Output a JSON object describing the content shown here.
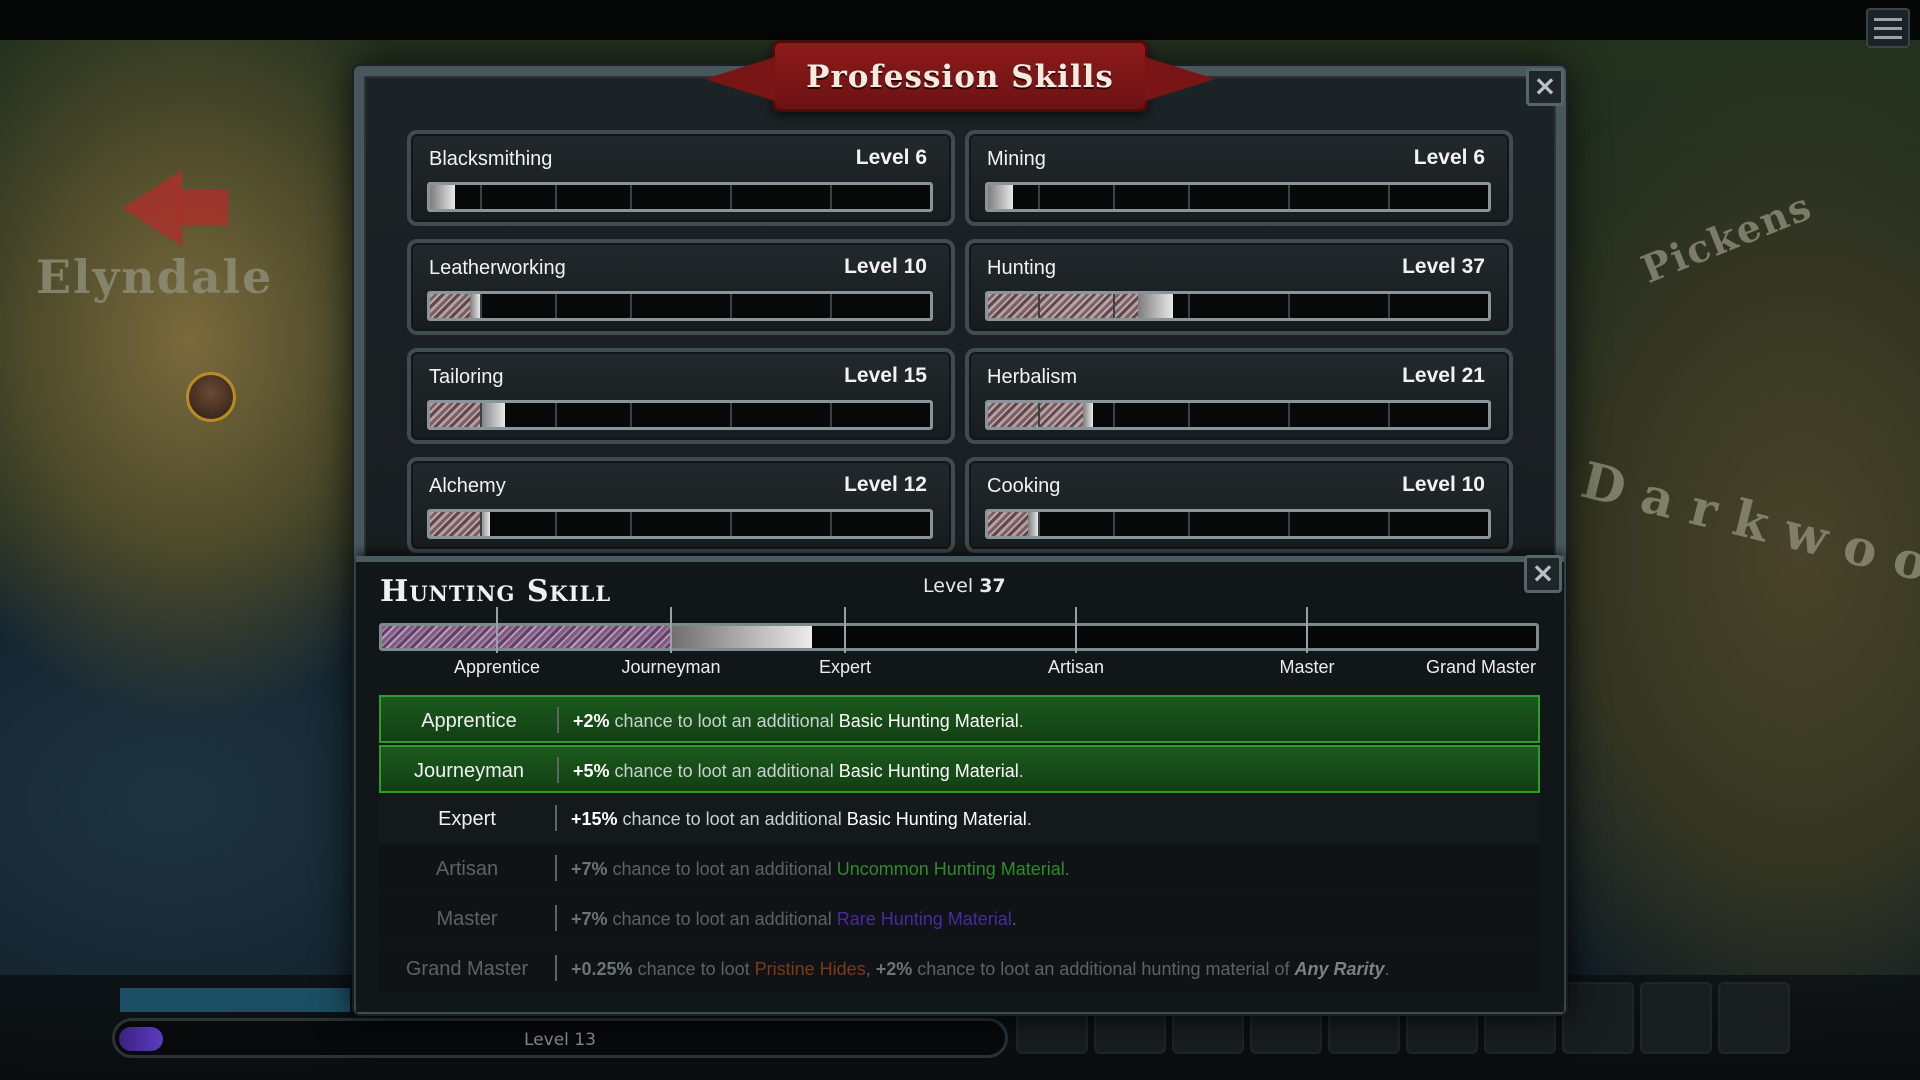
{
  "map": {
    "labels": {
      "elyndale": "Elyndale",
      "pickens": "Pickens",
      "darkwood": "Darkwood"
    }
  },
  "title": "Profession Skills",
  "close_label": "×",
  "skills": [
    {
      "name": "Blacksmithing",
      "level": "Level 6",
      "progress": 0.05
    },
    {
      "name": "Mining",
      "level": "Level 6",
      "progress": 0.05
    },
    {
      "name": "Leatherworking",
      "level": "Level 10",
      "progress": 0.1
    },
    {
      "name": "Hunting",
      "level": "Level 37",
      "progress": 0.37
    },
    {
      "name": "Tailoring",
      "level": "Level 15",
      "progress": 0.15
    },
    {
      "name": "Herbalism",
      "level": "Level 21",
      "progress": 0.21
    },
    {
      "name": "Alchemy",
      "level": "Level 12",
      "progress": 0.12
    },
    {
      "name": "Cooking",
      "level": "Level 10",
      "progress": 0.1
    }
  ],
  "detail": {
    "title": "Hunting Skill",
    "level_prefix": "Level",
    "level_value": "37",
    "tiers": [
      "Apprentice",
      "Journeyman",
      "Expert",
      "Artisan",
      "Master",
      "Grand Master"
    ],
    "perks": [
      {
        "tier": "Apprentice",
        "state": "unlocked",
        "value": "+2%",
        "text": " chance to loot an additional ",
        "material": "Basic Hunting Material",
        "end": "."
      },
      {
        "tier": "Journeyman",
        "state": "unlocked",
        "value": "+5%",
        "text": " chance to loot an additional ",
        "material": "Basic Hunting Material",
        "end": "."
      },
      {
        "tier": "Expert",
        "state": "current",
        "value": "+15%",
        "text": " chance to loot an additional ",
        "material": "Basic Hunting Material",
        "end": "."
      },
      {
        "tier": "Artisan",
        "state": "locked",
        "value": "+7%",
        "text": " chance to loot an additional ",
        "material": "Uncommon Hunting Material",
        "end": "."
      },
      {
        "tier": "Master",
        "state": "locked",
        "value": "+7%",
        "text": " chance to loot an additional ",
        "material": "Rare Hunting Material",
        "end": "."
      },
      {
        "tier": "Grand Master",
        "state": "locked",
        "value": "+0.25%",
        "text": " chance to loot ",
        "material": "Pristine Hides",
        "mid": ", ",
        "value2": "+2%",
        "text2": " chance to loot an additional hunting material of ",
        "material2": "Any Rarity",
        "end": "."
      }
    ]
  },
  "hud": {
    "level_label": "Level 13",
    "xp_progress": 0.05
  },
  "icons": {
    "close": "close-icon",
    "menu": "menu-icon",
    "marker": "map-marker-icon",
    "arrow": "map-arrow-icon"
  },
  "colors": {
    "banner": "#8e1a1b",
    "unlocked_row": "#1b5a1c",
    "uncommon": "#2f8a2a",
    "rare": "#4a2aa0",
    "pristine": "#7a3a1c"
  }
}
